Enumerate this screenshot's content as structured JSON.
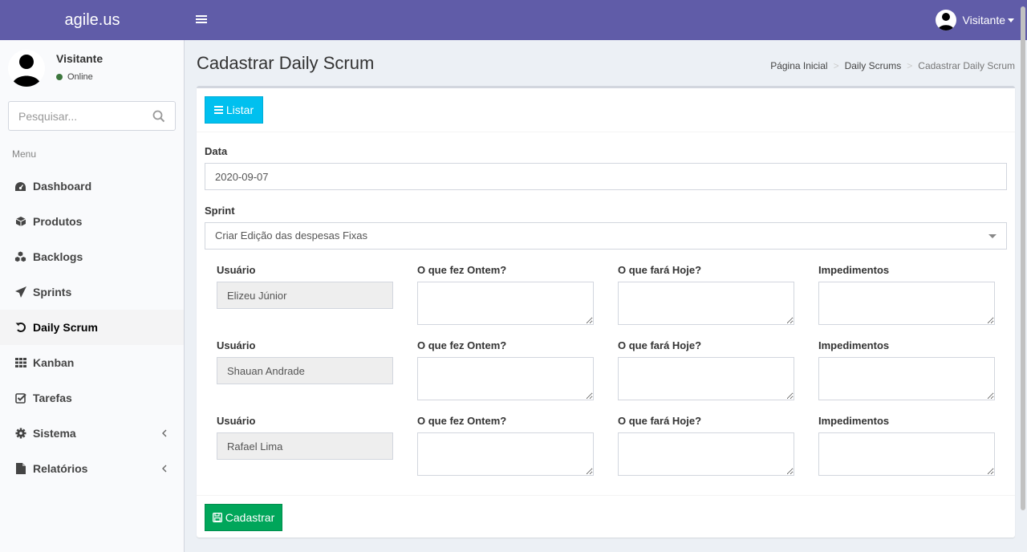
{
  "app": {
    "logo": "agile.us"
  },
  "topbar": {
    "user_name": "Visitante"
  },
  "sidebar": {
    "user": {
      "name": "Visitante",
      "status": "Online"
    },
    "search_placeholder": "Pesquisar...",
    "menu_header": "Menu",
    "items": [
      {
        "label": "Dashboard",
        "icon": "dashboard-icon"
      },
      {
        "label": "Produtos",
        "icon": "cube-icon"
      },
      {
        "label": "Backlogs",
        "icon": "cubes-icon"
      },
      {
        "label": "Sprints",
        "icon": "paper-plane-icon"
      },
      {
        "label": "Daily Scrum",
        "icon": "undo-icon",
        "active": true
      },
      {
        "label": "Kanban",
        "icon": "grid-icon"
      },
      {
        "label": "Tarefas",
        "icon": "check-square-icon"
      },
      {
        "label": "Sistema",
        "icon": "gear-icon",
        "expandable": true
      },
      {
        "label": "Relatórios",
        "icon": "file-icon",
        "expandable": true
      }
    ]
  },
  "page": {
    "title": "Cadastrar Daily Scrum",
    "breadcrumb": [
      "Página Inicial",
      "Daily Scrums",
      "Cadastrar Daily Scrum"
    ]
  },
  "form": {
    "list_button": "Listar",
    "data_label": "Data",
    "data_value": "2020-09-07",
    "sprint_label": "Sprint",
    "sprint_value": "Criar Edição das despesas Fixas",
    "col_labels": {
      "user": "Usuário",
      "yesterday": "O que fez Ontem?",
      "today": "O que fará Hoje?",
      "impediments": "Impedimentos"
    },
    "rows": [
      {
        "user": "Elizeu Júnior",
        "yesterday": "",
        "today": "",
        "impediments": ""
      },
      {
        "user": "Shauan Andrade",
        "yesterday": "",
        "today": "",
        "impediments": ""
      },
      {
        "user": "Rafael Lima",
        "yesterday": "",
        "today": "",
        "impediments": ""
      }
    ],
    "submit_button": "Cadastrar"
  },
  "colors": {
    "topbar": "#605ca8",
    "info_button": "#00c0ef",
    "success_button": "#00a65a",
    "online": "#3c763d"
  }
}
